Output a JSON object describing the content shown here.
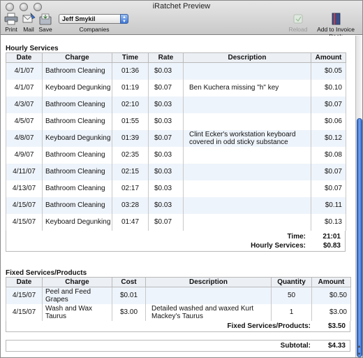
{
  "window": {
    "title": "iRatchet Preview"
  },
  "toolbar": {
    "print_label": "Print",
    "mail_label": "Mail",
    "save_label": "Save",
    "client_selected": "Jeff Smykil",
    "companies_label": "Companies",
    "reload_label": "Reload",
    "add_book_label": "Add to Invoice Book"
  },
  "hourly": {
    "title": "Hourly Services",
    "columns": [
      "Date",
      "Charge",
      "Time",
      "Rate",
      "Description",
      "Amount"
    ],
    "rows": [
      {
        "date": "4/1/07",
        "charge": "Bathroom Cleaning",
        "time": "01:36",
        "rate": "$0.03",
        "description": "",
        "amount": "$0.05"
      },
      {
        "date": "4/1/07",
        "charge": "Keyboard Degunking",
        "time": "01:19",
        "rate": "$0.07",
        "description": "Ben Kuchera missing \"h\" key",
        "amount": "$0.10"
      },
      {
        "date": "4/3/07",
        "charge": "Bathroom Cleaning",
        "time": "02:10",
        "rate": "$0.03",
        "description": "",
        "amount": "$0.07"
      },
      {
        "date": "4/5/07",
        "charge": "Bathroom Cleaning",
        "time": "01:55",
        "rate": "$0.03",
        "description": "",
        "amount": "$0.06"
      },
      {
        "date": "4/8/07",
        "charge": "Keyboard Degunking",
        "time": "01:39",
        "rate": "$0.07",
        "description": "Clint Ecker's workstation keyboard covered in odd sticky substance",
        "amount": "$0.12"
      },
      {
        "date": "4/9/07",
        "charge": "Bathroom Cleaning",
        "time": "02:35",
        "rate": "$0.03",
        "description": "",
        "amount": "$0.08"
      },
      {
        "date": "4/11/07",
        "charge": "Bathroom Cleaning",
        "time": "02:15",
        "rate": "$0.03",
        "description": "",
        "amount": "$0.07"
      },
      {
        "date": "4/13/07",
        "charge": "Bathroom Cleaning",
        "time": "02:17",
        "rate": "$0.03",
        "description": "",
        "amount": "$0.07"
      },
      {
        "date": "4/15/07",
        "charge": "Bathroom Cleaning",
        "time": "03:28",
        "rate": "$0.03",
        "description": "",
        "amount": "$0.11"
      },
      {
        "date": "4/15/07",
        "charge": "Keyboard Degunking",
        "time": "01:47",
        "rate": "$0.07",
        "description": "",
        "amount": "$0.13"
      }
    ],
    "time_label": "Time:",
    "time_total": "21:01",
    "services_label": "Hourly Services:",
    "services_total": "$0.83"
  },
  "fixed": {
    "title": "Fixed Services/Products",
    "columns": [
      "Date",
      "Charge",
      "Cost",
      "Description",
      "Quantity",
      "Amount"
    ],
    "rows": [
      {
        "date": "4/15/07",
        "charge": "Peel and Feed Grapes",
        "cost": "$0.01",
        "description": "",
        "quantity": "50",
        "amount": "$0.50"
      },
      {
        "date": "4/15/07",
        "charge": "Wash and Wax Taurus",
        "cost": "$3.00",
        "description": "Detailed washed and waxed Kurt Mackey's Taurus",
        "quantity": "1",
        "amount": "$3.00"
      }
    ],
    "total_label": "Fixed Services/Products:",
    "total_value": "$3.50"
  },
  "summary": {
    "subtotal_label": "Subtotal:",
    "subtotal_value": "$4.33"
  }
}
